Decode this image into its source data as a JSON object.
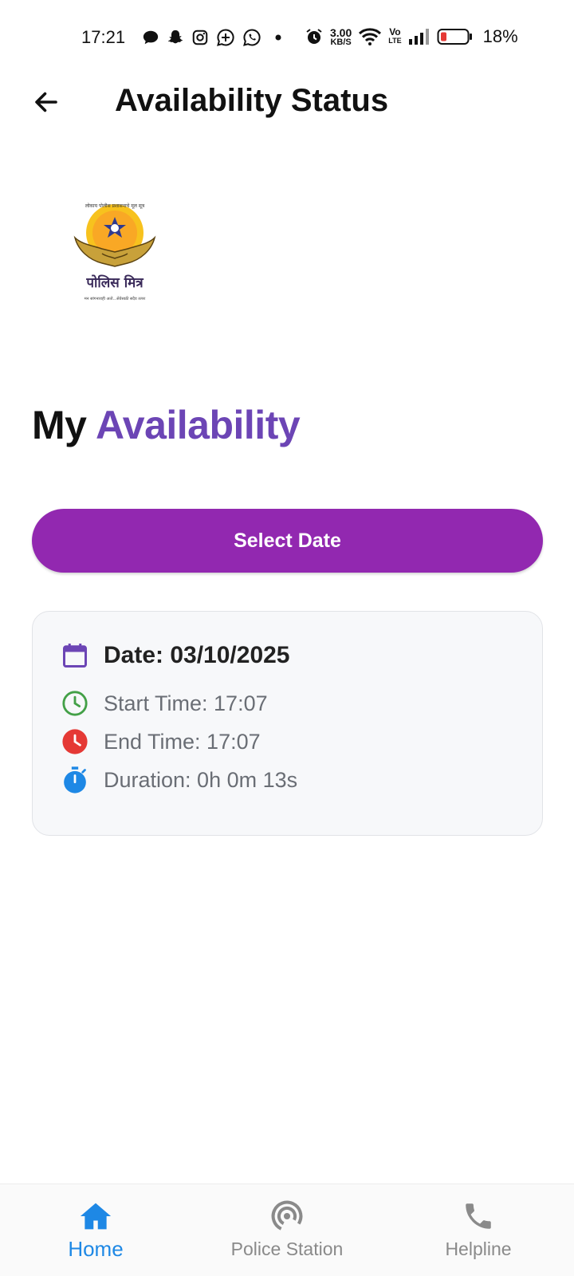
{
  "status_bar": {
    "time": "17:21",
    "net_speed_value": "3.00",
    "net_speed_unit": "KB/S",
    "volte_top": "Vo",
    "volte_bottom": "LTE",
    "battery_percent": "18%"
  },
  "app_bar": {
    "title": "Availability Status"
  },
  "logo": {
    "caption": "पोलिस मित्र",
    "arc_text": "लोकाय पोलीस प्रशासनाचे मूल सूत्र",
    "tagline": "मन सांगनाराही अतो...सेवेसाठी सदैव तत्पर"
  },
  "heading": {
    "part1": "My",
    "part2": "Availability"
  },
  "select_date_button": {
    "label": "Select Date"
  },
  "card": {
    "date": "Date: 03/10/2025",
    "start_time": "Start Time: 17:07",
    "end_time": "End Time: 17:07",
    "duration": "Duration: 0h 0m 13s"
  },
  "bottom_nav": {
    "items": [
      {
        "label": "Home",
        "icon": "home-icon",
        "active": true
      },
      {
        "label": "Police Station",
        "icon": "radar-icon",
        "active": false
      },
      {
        "label": "Helpline",
        "icon": "phone-icon",
        "active": false
      }
    ]
  },
  "colors": {
    "accent_purple": "#6c45b5",
    "button_purple": "#9228b0",
    "active_blue": "#1e88e5",
    "green": "#43a047",
    "red": "#e53935",
    "blue": "#1e88e5"
  }
}
